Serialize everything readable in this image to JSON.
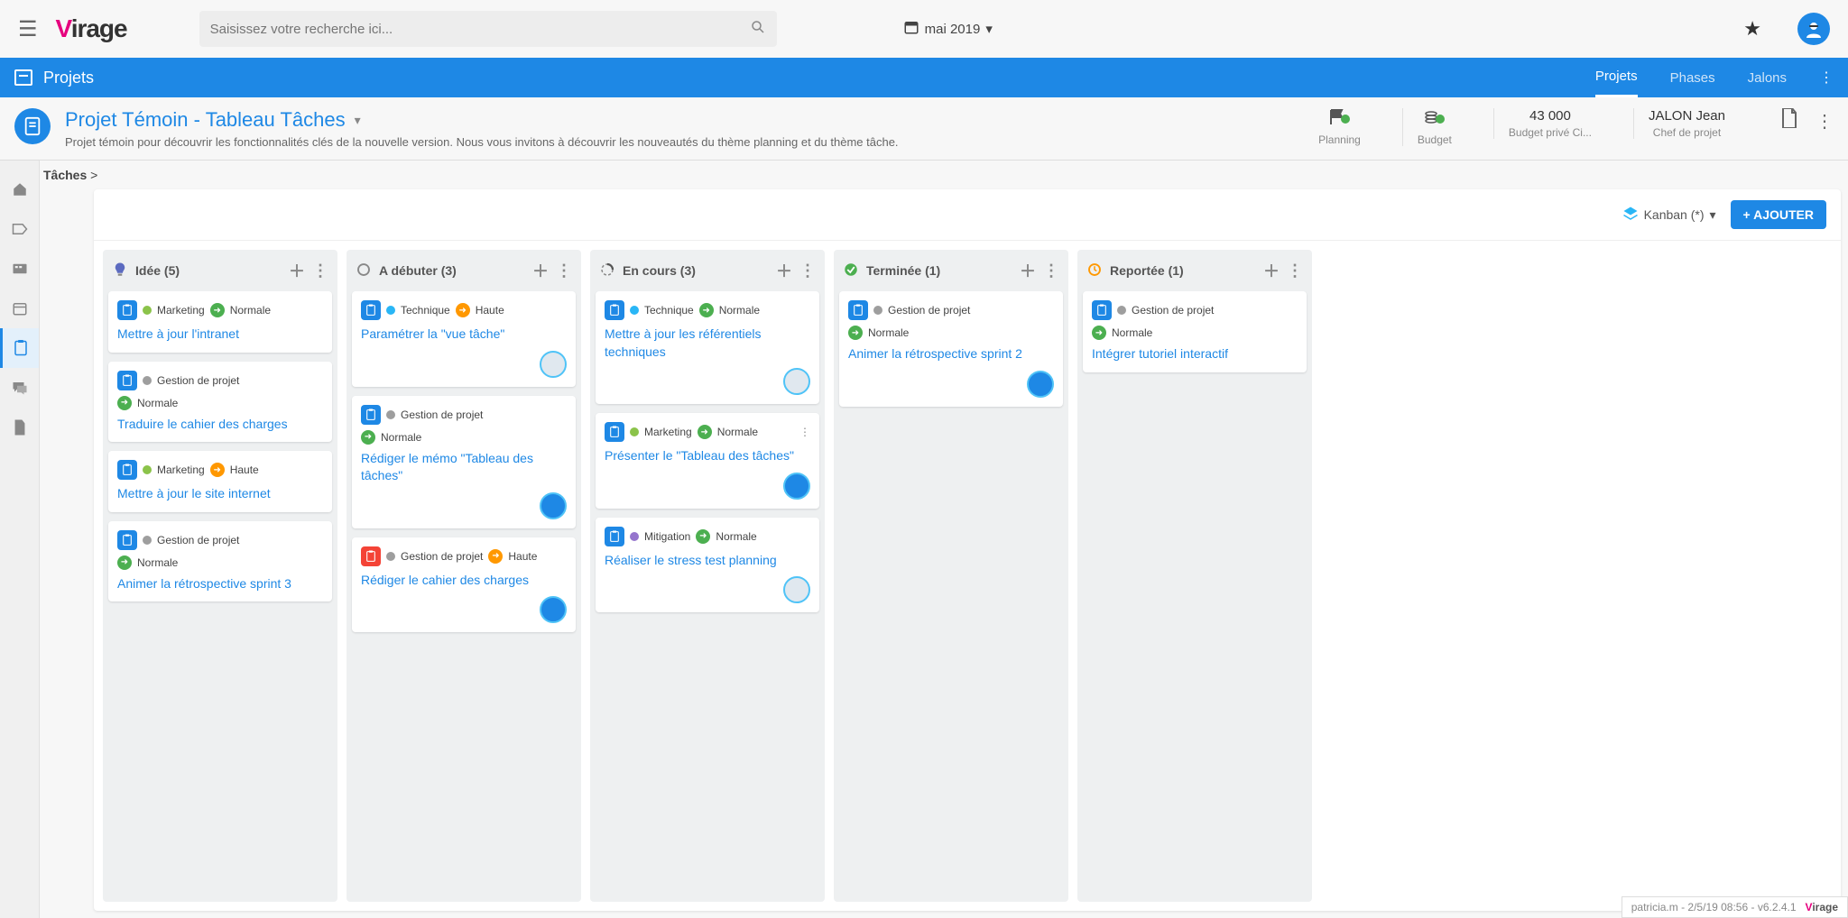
{
  "search": {
    "placeholder": "Saisissez votre recherche ici..."
  },
  "date": "mai 2019",
  "nav": {
    "section": "Projets",
    "tabs": [
      "Projets",
      "Phases",
      "Jalons"
    ],
    "active": 0
  },
  "project": {
    "title": "Projet Témoin - Tableau Tâches",
    "desc": "Projet témoin pour découvrir les fonctionnalités clés de la nouvelle version. Nous vous invitons à découvrir les nouveautés du thème planning et du thème tâche."
  },
  "metrics": {
    "planning_label": "Planning",
    "budget_label": "Budget",
    "private_value": "43 000",
    "private_label": "Budget privé Ci...",
    "chief_value": "JALON Jean",
    "chief_label": "Chef de projet"
  },
  "breadcrumb": {
    "main": "Tâches",
    "sep": " >"
  },
  "toolbar": {
    "view": "Kanban (*)",
    "add": "+ AJOUTER"
  },
  "priority": {
    "normale": "Normale",
    "haute": "Haute"
  },
  "category": {
    "marketing": "Marketing",
    "technique": "Technique",
    "gestion": "Gestion de projet",
    "mitigation": "Mitigation"
  },
  "columns": [
    {
      "key": "idea",
      "title": "Idée (5)",
      "icon": "bulb"
    },
    {
      "key": "todo",
      "title": "A débuter (3)",
      "icon": "circle"
    },
    {
      "key": "doing",
      "title": "En cours (3)",
      "icon": "progress"
    },
    {
      "key": "done",
      "title": "Terminée (1)",
      "icon": "check"
    },
    {
      "key": "postponed",
      "title": "Reportée (1)",
      "icon": "clock"
    }
  ],
  "cards": {
    "idea": [
      {
        "cat": "marketing",
        "catColor": "#8bc34a",
        "prio": "normale",
        "prioColor": "green",
        "title": "Mettre à jour l'intranet",
        "badge": "blue"
      },
      {
        "cat": "gestion",
        "catColor": "#9e9e9e",
        "prio": "normale",
        "prioColor": "green",
        "title": "Traduire le cahier des charges",
        "badge": "blue",
        "twoLine": true
      },
      {
        "cat": "marketing",
        "catColor": "#8bc34a",
        "prio": "haute",
        "prioColor": "orange",
        "title": "Mettre à jour le site internet",
        "badge": "blue"
      },
      {
        "cat": "gestion",
        "catColor": "#9e9e9e",
        "prio": "normale",
        "prioColor": "green",
        "title": "Animer la rétrospective sprint 3",
        "badge": "blue",
        "twoLine": true
      }
    ],
    "todo": [
      {
        "cat": "technique",
        "catColor": "#29b6f6",
        "prio": "haute",
        "prioColor": "orange",
        "title": "Paramétrer la \"vue tâche\"",
        "badge": "blue",
        "assignee": "light"
      },
      {
        "cat": "gestion",
        "catColor": "#9e9e9e",
        "prio": "normale",
        "prioColor": "green",
        "title": "Rédiger le mémo \"Tableau des tâches\"",
        "badge": "blue",
        "twoLine": true,
        "assignee": "dark"
      },
      {
        "cat": "gestion",
        "catColor": "#9e9e9e",
        "prio": "haute",
        "prioColor": "orange",
        "title": "Rédiger le cahier des charges",
        "badge": "red",
        "assignee": "dark"
      }
    ],
    "doing": [
      {
        "cat": "technique",
        "catColor": "#29b6f6",
        "prio": "normale",
        "prioColor": "green",
        "title": "Mettre à jour les référentiels techniques",
        "badge": "blue",
        "assignee": "light"
      },
      {
        "cat": "marketing",
        "catColor": "#8bc34a",
        "prio": "normale",
        "prioColor": "green",
        "title": "Présenter le \"Tableau des tâches\"",
        "badge": "blue",
        "assignee": "dark",
        "showMore": true
      },
      {
        "cat": "mitigation",
        "catColor": "#9575cd",
        "prio": "normale",
        "prioColor": "green",
        "title": "Réaliser le stress test planning",
        "badge": "blue",
        "assignee": "light"
      }
    ],
    "done": [
      {
        "cat": "gestion",
        "catColor": "#9e9e9e",
        "prio": "normale",
        "prioColor": "green",
        "title": "Animer la rétrospective sprint 2",
        "badge": "blue",
        "twoLine": true,
        "assignee": "dark"
      }
    ],
    "postponed": [
      {
        "cat": "gestion",
        "catColor": "#9e9e9e",
        "prio": "normale",
        "prioColor": "green",
        "title": "Intégrer tutoriel interactif",
        "badge": "blue",
        "twoLine": true
      }
    ]
  },
  "footer": {
    "status": "patricia.m - 2/5/19 08:56 - v6.2.4.1"
  }
}
